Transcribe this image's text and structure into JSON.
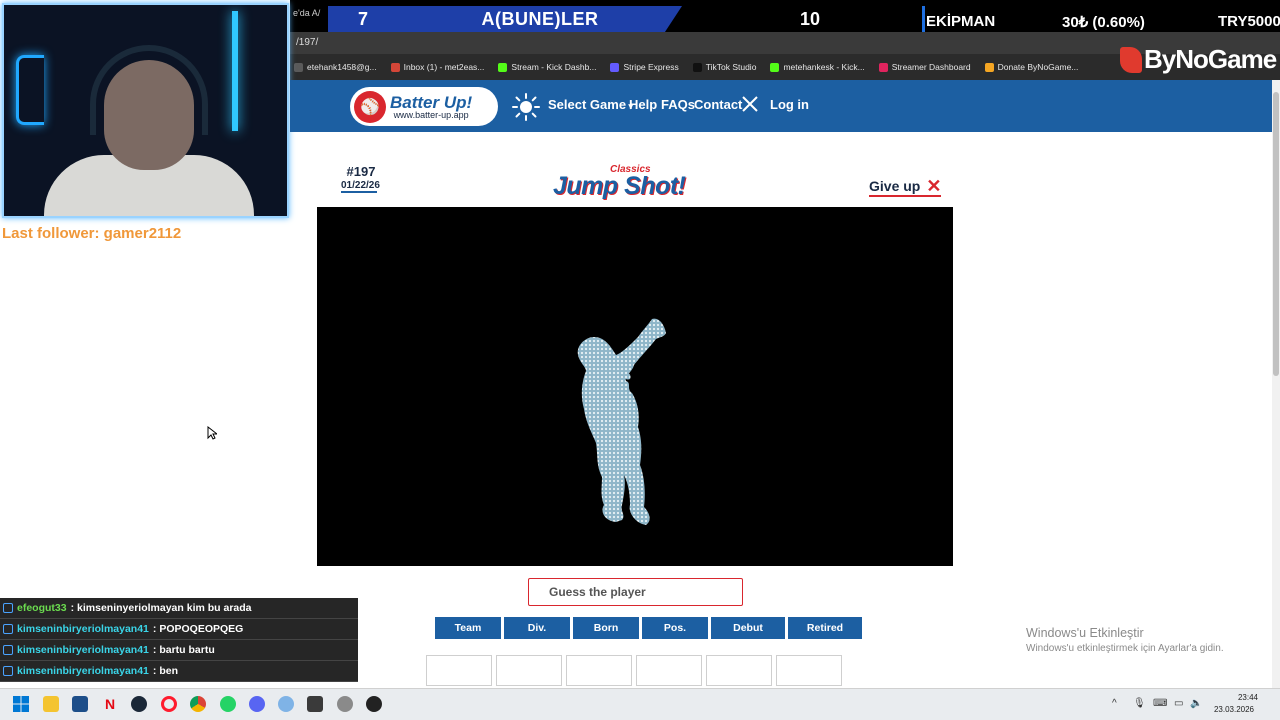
{
  "stream_overlay": {
    "tab_fragment": "e'da A/",
    "score_left": "7",
    "team_name": "A(BUNE)LER",
    "score_right": "10",
    "label_ekipman": "EKİPMAN",
    "percent_text": "30₺ (0.60%)",
    "currency_text": "TRY5000",
    "last_follower": "Last follower: gamer2112",
    "brand": "ByNoGame"
  },
  "browser": {
    "url_fragment": "/197/",
    "bookmarks": [
      {
        "label": "etehank1458@g...",
        "icon": "account-icon",
        "color": "#5a5a5a"
      },
      {
        "label": "Inbox (1) - met2eas...",
        "icon": "gmail-icon",
        "color": "#d44638"
      },
      {
        "label": "Stream - Kick Dashb...",
        "icon": "kick-icon",
        "color": "#53fc18"
      },
      {
        "label": "Stripe Express",
        "icon": "stripe-icon",
        "color": "#635bff"
      },
      {
        "label": "TikTok Studio",
        "icon": "tiktok-icon",
        "color": "#111111"
      },
      {
        "label": "metehankesk - Kick...",
        "icon": "kick-icon",
        "color": "#53fc18"
      },
      {
        "label": "Streamer Dashboard",
        "icon": "dashboard-icon",
        "color": "#e0245e"
      },
      {
        "label": "Donate ByNoGame...",
        "icon": "donate-icon",
        "color": "#f5a623"
      }
    ]
  },
  "chat": [
    {
      "user": "efeogut33",
      "message": " : kimseninyeriolmayan kim bu arada",
      "color": "#6bdc4f"
    },
    {
      "user": "kimseninbiryeriolmayan41",
      "message": " : POPOQEOPQEG",
      "color": "#3ad5e8"
    },
    {
      "user": "kimseninbiryeriolmayan41",
      "message": " : bartu bartu",
      "color": "#3ad5e8"
    },
    {
      "user": "kimseninbiryeriolmayan41",
      "message": " : ben",
      "color": "#3ad5e8"
    }
  ],
  "site": {
    "logo_title": "Batter Up!",
    "logo_url": "www.batter-up.app",
    "nav": {
      "select_game": "Select Game",
      "help": "Help",
      "faqs": "FAQs",
      "contact": "Contact",
      "login": "Log in"
    },
    "puzzle_number": "#197",
    "puzzle_date": "01/22/26",
    "game_subtitle": "Classics",
    "game_title": "Jump Shot!",
    "give_up": "Give up",
    "guess_placeholder": "Guess the player",
    "columns": [
      "Team",
      "Div.",
      "Born",
      "Pos.",
      "Debut",
      "Retired"
    ],
    "accent": "#1c5fa2",
    "danger": "#d9272e"
  },
  "windows": {
    "activate_title": "Windows'u Etkinleştir",
    "activate_sub": "Windows'u etkinleştirmek için Ayarlar'a gidin.",
    "time": "23:44",
    "date": "23.03.2026"
  }
}
